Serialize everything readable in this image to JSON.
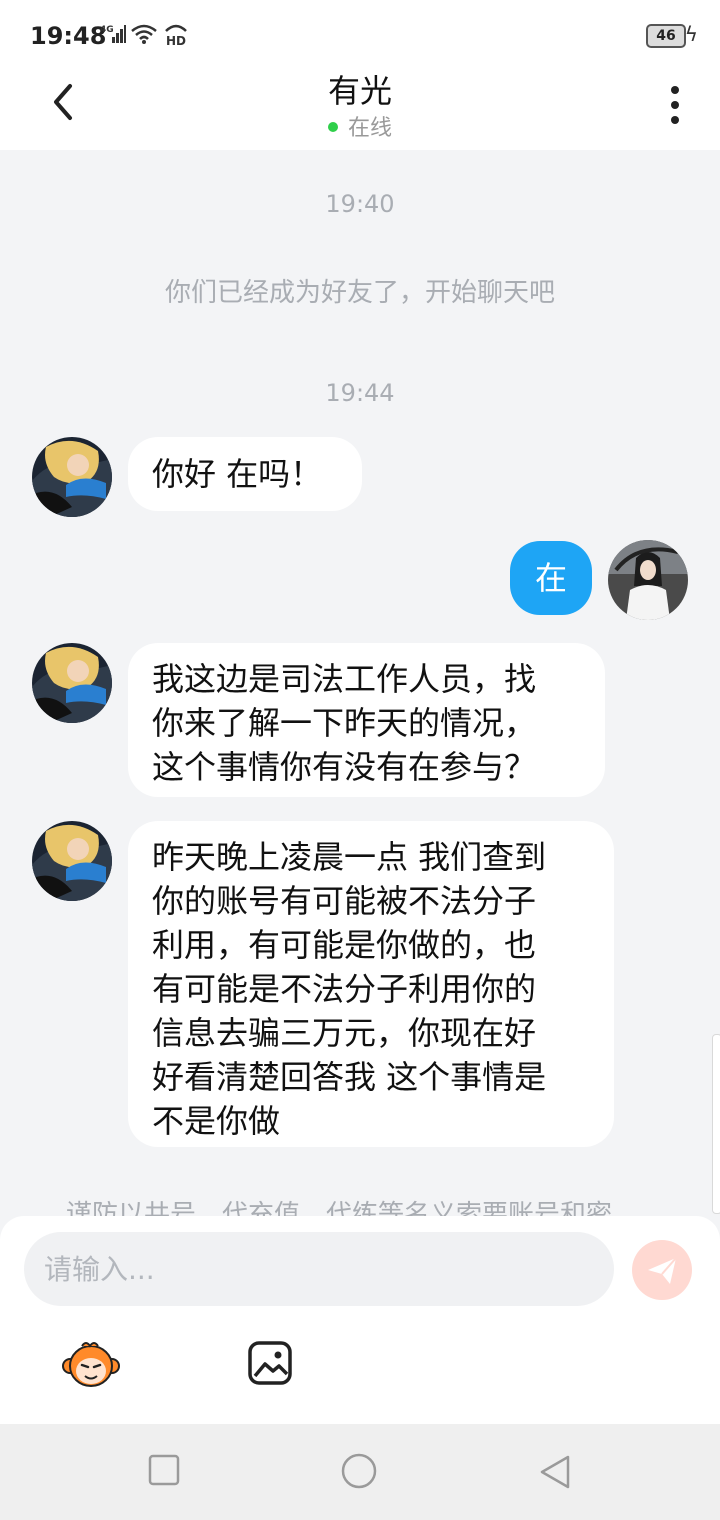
{
  "status_bar": {
    "time": "19:48",
    "network": "4G",
    "hd": "HD",
    "battery": "46"
  },
  "header": {
    "title": "有光",
    "status": "在线"
  },
  "messages": {
    "time1": "19:40",
    "system": "你们已经成为好友了，开始聊天吧",
    "time2": "19:44",
    "m1": "你好 在吗！",
    "m2": "在",
    "m3_lines": [
      "我这边是司法工作人员，找",
      "你来了解一下昨天的情况，",
      "这个事情你有没有在参与？"
    ],
    "m4_lines": [
      "昨天晚上凌晨一点 我们查到",
      "你的账号有可能被不法分子",
      "利用，有可能是你做的，也",
      "有可能是不法分子利用你的",
      "信息去骗三万元，你现在好",
      "好看清楚回答我 这个事情是",
      "不是你做"
    ],
    "cut_notice": "谨防以共号、代充值、代练等名义索要账号和密"
  },
  "input": {
    "placeholder": "请输入..."
  },
  "icons": {
    "back": "back-arrow-icon",
    "more": "more-vertical-icon",
    "send": "send-icon",
    "emoji": "monkey-emoji-icon",
    "image": "image-icon",
    "nav": [
      "square-icon",
      "circle-icon",
      "triangle-icon"
    ]
  },
  "colors": {
    "accent": "#1ea5f5",
    "online": "#2fcf4a",
    "send_inactive": "#ffd9d2",
    "background": "#f3f4f6"
  }
}
